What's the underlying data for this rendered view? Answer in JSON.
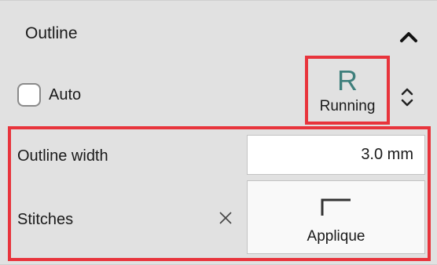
{
  "outline": {
    "title": "Outline",
    "collapse_icon": "chevron-up-icon",
    "auto": {
      "label": "Auto",
      "checked": false
    },
    "stitch_type": {
      "glyph": "R",
      "label": "Running"
    },
    "spinner_icon": "updown-chevron-icon",
    "outline_width": {
      "label": "Outline width",
      "value": "3.0 mm"
    },
    "stitches": {
      "label": "Stitches",
      "clear_icon": "close-icon",
      "button_label": "Applique",
      "button_icon": "applique-corner-icon"
    }
  },
  "colors": {
    "highlight": "#e8343c",
    "panel_bg": "#e1e1e1",
    "glyph": "#3f7f7c"
  }
}
